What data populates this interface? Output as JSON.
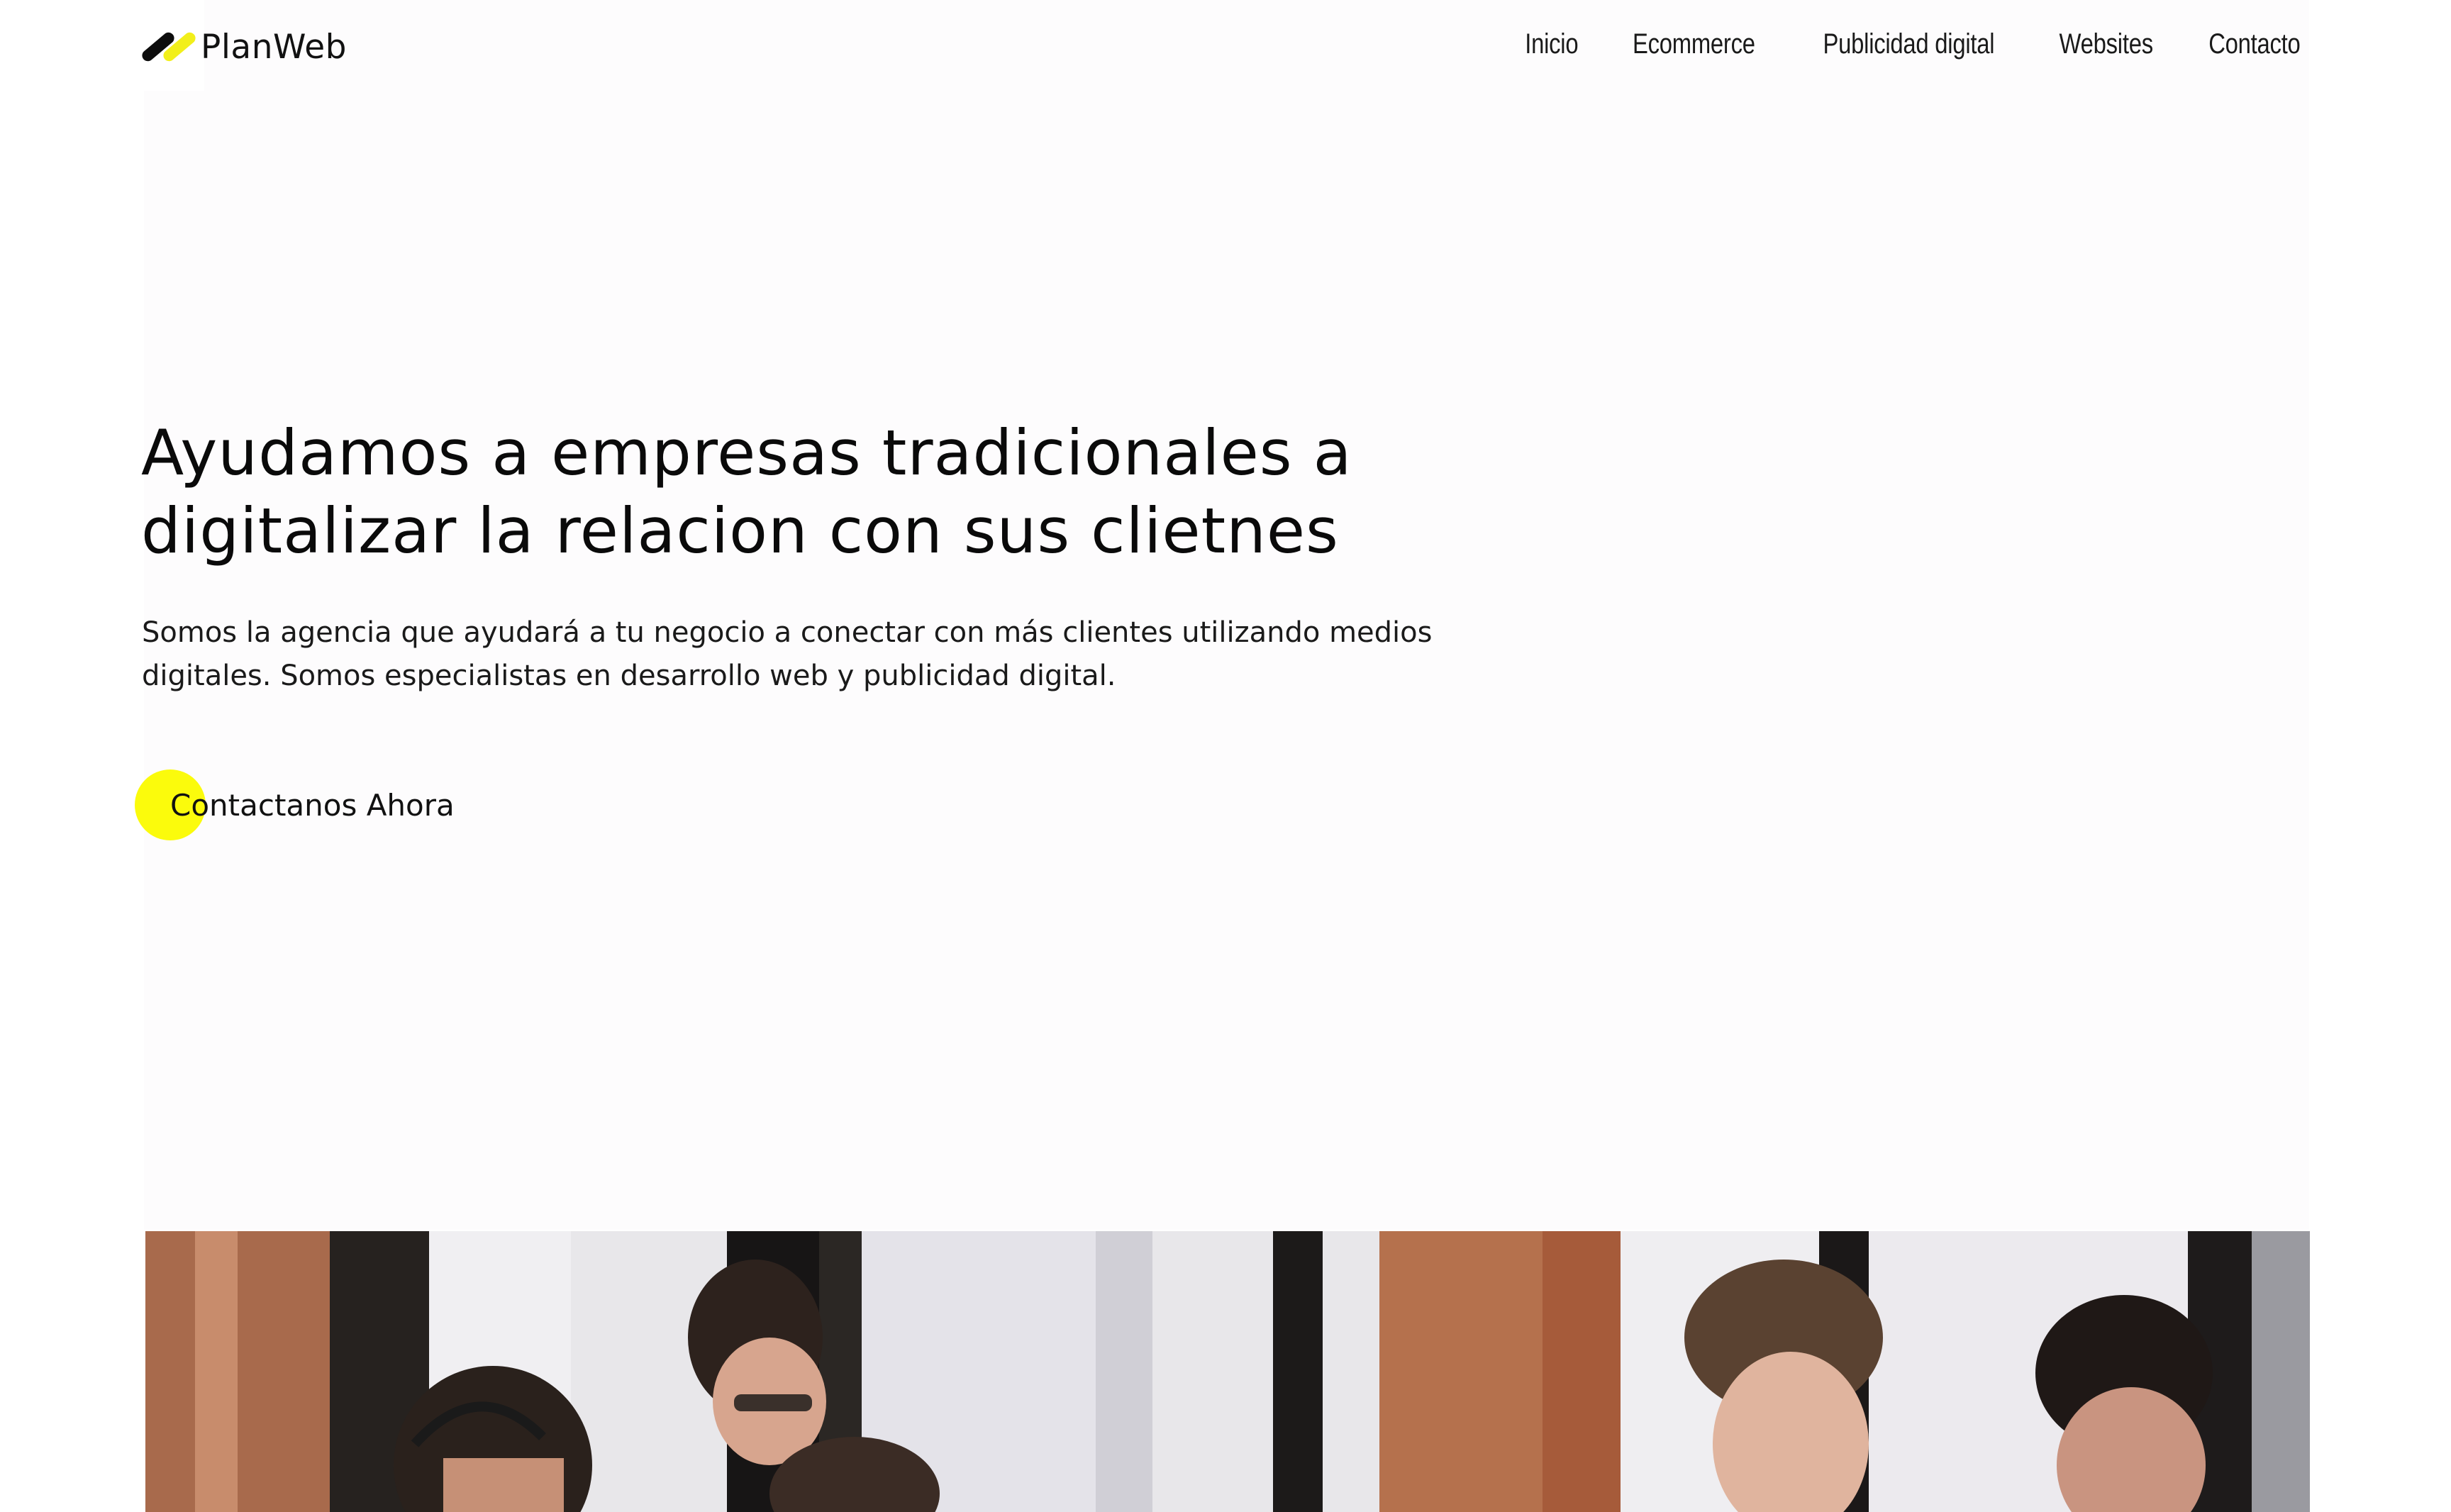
{
  "brand": {
    "name": "PlanWeb",
    "accent_color": "#f4f21c",
    "text_color": "#0a0a0a"
  },
  "nav": {
    "items": [
      "Inicio",
      "Ecommerce",
      "Publicidad digital",
      "Websites",
      "Contacto"
    ]
  },
  "hero": {
    "title_before": "Ayudamos a ",
    "title_highlight": "empresas",
    "title_after": " tradicionales a digitalizar la relacion con sus clietnes",
    "subtitle": "Somos la agencia que ayudará a tu negocio a conectar con más clientes utilizando medios digitales. Somos especialistas en desarrollo web y publicidad digital.",
    "cta_label": "Contactanos Ahora",
    "cta_color": "#fbfb0c"
  },
  "photo": {
    "icon": "team-photo"
  }
}
